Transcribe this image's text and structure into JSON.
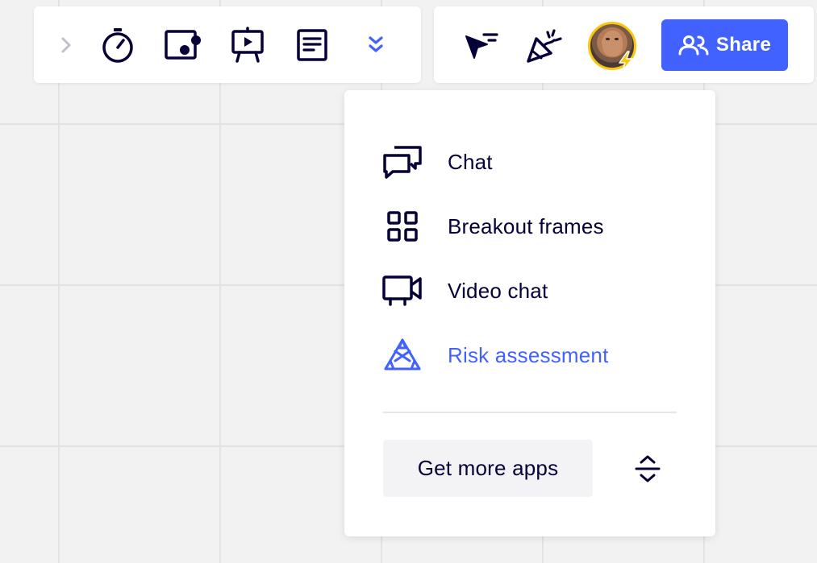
{
  "toolbar": {
    "collaboration_tools": [
      {
        "icon": "chevron-right-icon",
        "color": "#c1c1c9"
      },
      {
        "icon": "timer-icon"
      },
      {
        "icon": "screen-share-icon"
      },
      {
        "icon": "presentation-icon"
      },
      {
        "icon": "notes-icon"
      },
      {
        "icon": "double-chevron-down-icon",
        "color": "#4262ff"
      }
    ],
    "actions": [
      {
        "icon": "cursor-flag-icon"
      },
      {
        "icon": "party-popper-icon"
      }
    ],
    "share_label": "Share",
    "share_color": "#4262ff",
    "avatar_ring_color": "#fac710"
  },
  "apps_menu": {
    "items": [
      {
        "label": "Chat",
        "icon": "chat-icon",
        "color": "#050038"
      },
      {
        "label": "Breakout frames",
        "icon": "grid-icon",
        "color": "#050038"
      },
      {
        "label": "Video chat",
        "icon": "video-camera-icon",
        "color": "#050038"
      },
      {
        "label": "Risk assessment",
        "icon": "risk-triangle-icon",
        "color": "#4262ff"
      }
    ],
    "get_more_label": "Get more apps",
    "toggle_icon": "expand-collapse-icon"
  }
}
